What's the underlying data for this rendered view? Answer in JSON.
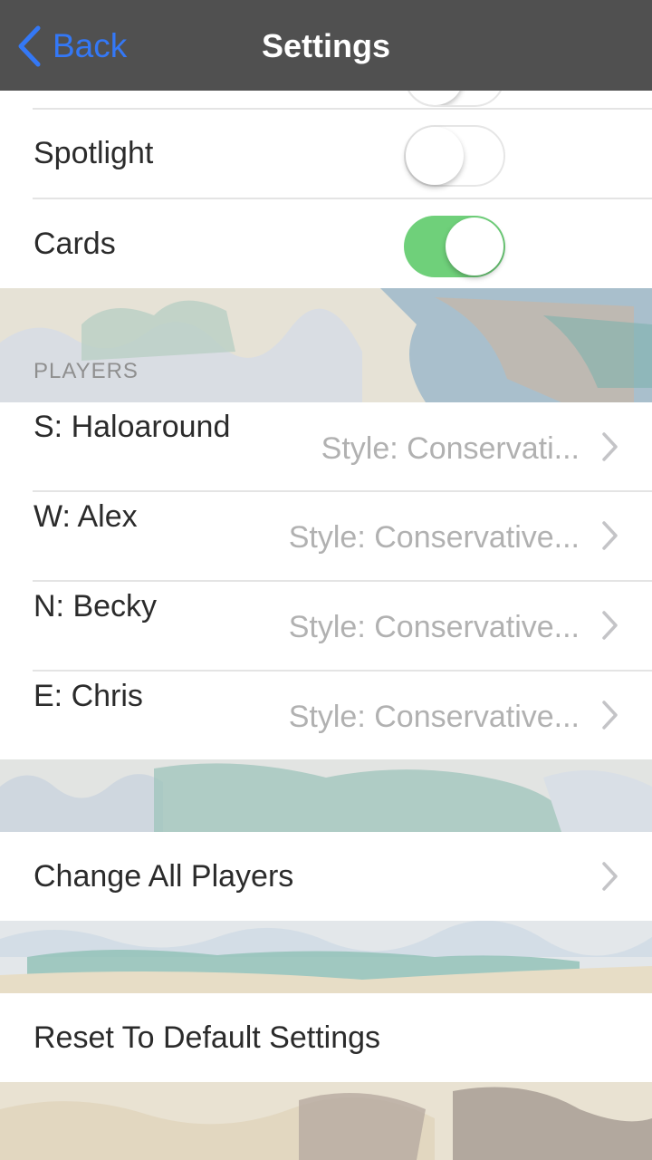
{
  "nav": {
    "back_label": "Back",
    "title": "Settings"
  },
  "toggles": [
    {
      "label": "Spotlight",
      "on": false
    },
    {
      "label": "Cards",
      "on": true
    }
  ],
  "players_section": {
    "header": "PLAYERS",
    "players": [
      {
        "name": "S: Haloaround",
        "style": "Style: Conservati..."
      },
      {
        "name": "W: Alex",
        "style": "Style: Conservative..."
      },
      {
        "name": "N: Becky",
        "style": "Style: Conservative..."
      },
      {
        "name": "E: Chris",
        "style": "Style: Conservative..."
      }
    ]
  },
  "actions": {
    "change_all": "Change All Players",
    "reset": "Reset To Default Settings"
  },
  "colors": {
    "accent": "#3478f6",
    "switch_on": "#6fd07a",
    "nav_bg": "#505050"
  }
}
